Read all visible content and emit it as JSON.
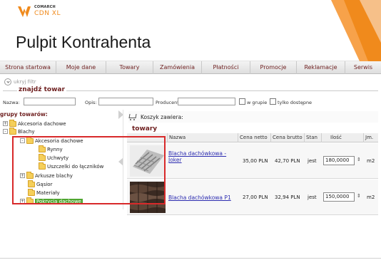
{
  "header": {
    "logo_top": "COMARCH",
    "logo_bottom": "CDN XL",
    "title": "Pulpit Kontrahenta"
  },
  "nav": [
    "Strona startowa",
    "Moje dane",
    "Towary",
    "Zamówienia",
    "Płatności",
    "Promocje",
    "Reklamacje",
    "Serwis"
  ],
  "filter_toggle": "ukryj filtr",
  "search": {
    "legend": "znajdź towar",
    "name_label": "Nazwa:",
    "desc_label": "Opis:",
    "producer_label": "Producent:",
    "in_group_label": "w grupie",
    "available_label": "tylko dostępne"
  },
  "tree": {
    "title": "grupy towarów:",
    "items": [
      {
        "label": "Akcesoria dachowe",
        "expander": "+"
      },
      {
        "label": "Blachy",
        "expander": "-"
      },
      {
        "label": "Akcesoria dachowe",
        "expander": "-"
      },
      {
        "label": "Rynny",
        "expander": ""
      },
      {
        "label": "Uchwyty",
        "expander": ""
      },
      {
        "label": "Uszczelki do łączników",
        "expander": ""
      },
      {
        "label": "Arkusze blachy",
        "expander": "+"
      },
      {
        "label": "Gąsior",
        "expander": ""
      },
      {
        "label": "Materiały",
        "expander": ""
      },
      {
        "label": "Pokrycia dachowe",
        "expander": "+"
      }
    ]
  },
  "cart": {
    "label": "Koszyk zawiera:"
  },
  "products": {
    "title": "towary",
    "columns": [
      "Nazwa",
      "Cena netto",
      "Cena brutto",
      "Stan",
      "Ilość",
      "Jm."
    ],
    "rows": [
      {
        "name": "Blacha dachówkowa - Joker",
        "net": "35,00 PLN",
        "gross": "42,70 PLN",
        "stock": "jest",
        "qty": "180,0000",
        "unit": "m2"
      },
      {
        "name": "Blacha dachówkowa P1",
        "net": "27,00 PLN",
        "gross": "32,94 PLN",
        "stock": "jest",
        "qty": "150,0000",
        "unit": "m2"
      }
    ]
  },
  "colors": {
    "accent": "#f08a1c",
    "maroon": "#6e1f1f",
    "highlight_green": "#4fa630",
    "annotation_red": "#d8292a"
  }
}
